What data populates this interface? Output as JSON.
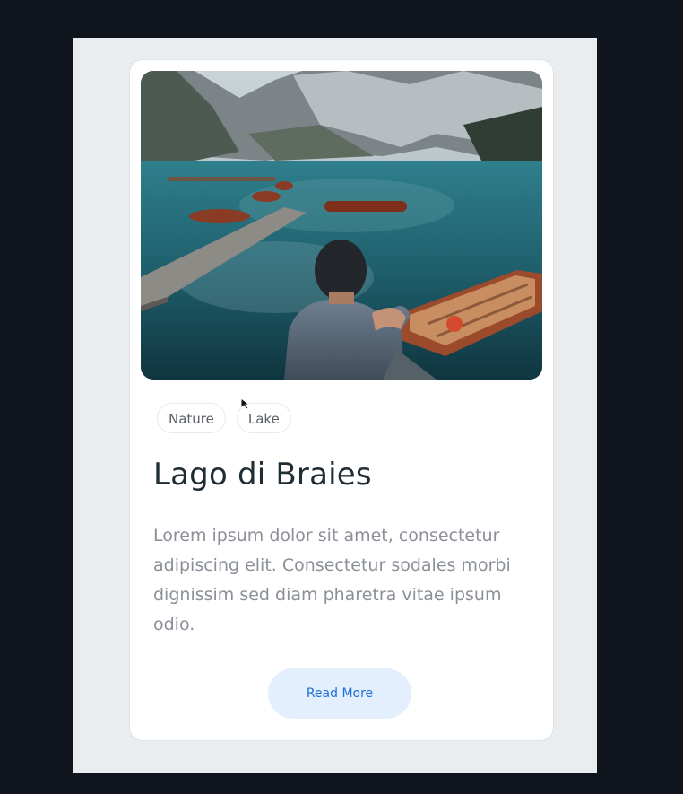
{
  "card": {
    "photo_alt": "Man sitting on a dock by a mountain lake with wooden boats",
    "tags": [
      "Nature",
      "Lake"
    ],
    "title": "Lago di Braies",
    "description": "Lorem ipsum dolor sit amet, consectetur adipiscing elit. Consectetur sodales morbi dignissim sed diam pharetra vitae ipsum odio.",
    "button_label": "Read More"
  },
  "colors": {
    "background": "#10141c",
    "stage": "#e9edf0",
    "card": "#ffffff",
    "title": "#1f2d35",
    "description": "#8a8f98",
    "button_bg": "#e3effd",
    "button_text": "#1e6fd9"
  }
}
